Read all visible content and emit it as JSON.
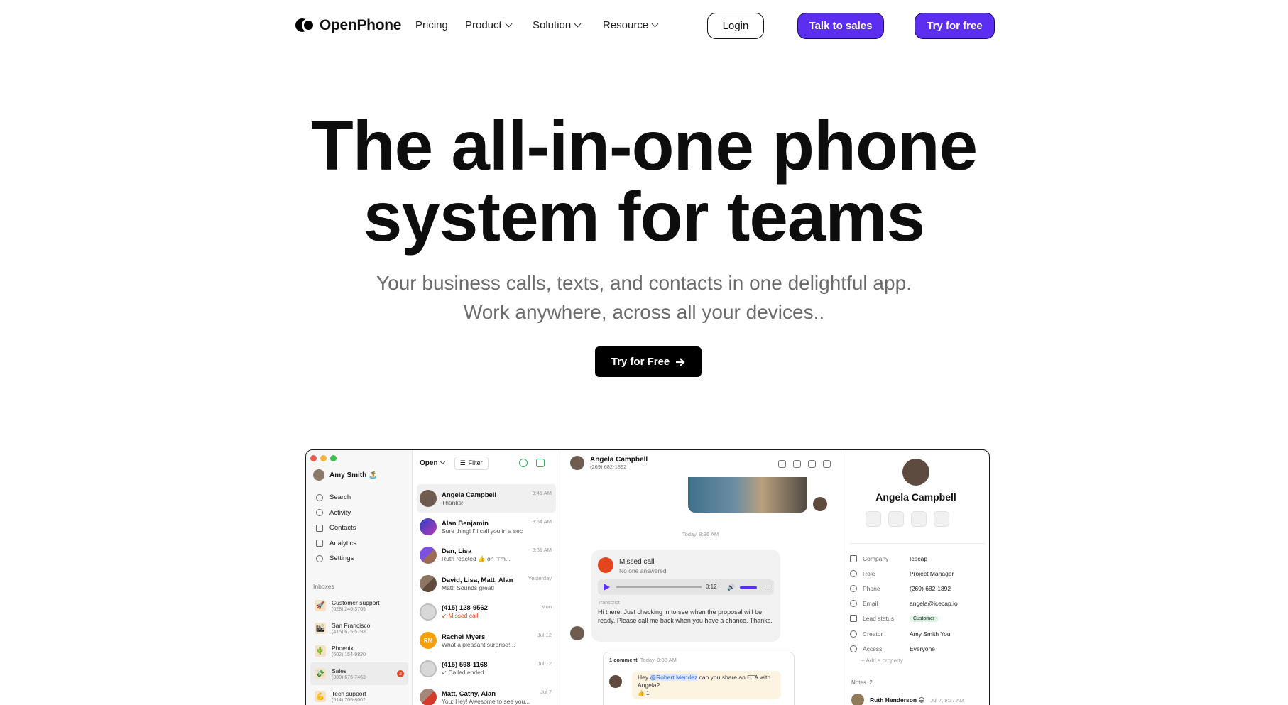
{
  "nav": {
    "brand": "OpenPhone",
    "links": [
      {
        "label": "Pricing",
        "dropdown": false
      },
      {
        "label": "Product",
        "dropdown": true
      },
      {
        "label": "Solution",
        "dropdown": true
      },
      {
        "label": "Resource",
        "dropdown": true
      }
    ],
    "login": "Login",
    "talk_to_sales": "Talk to sales",
    "try_free": "Try for free"
  },
  "hero": {
    "title_line1": "The all-in-one phone",
    "title_line2": "system for teams",
    "subtitle_line1": "Your business calls, texts, and contacts in one delightful app.",
    "subtitle_line2": "Work anywhere, across all your devices..",
    "cta": "Try for Free",
    "cta_icon": "arrow-right-icon"
  },
  "colors": {
    "accent": "#5b2ef0",
    "missed": "#e3461f",
    "success": "#2cb45a"
  },
  "app": {
    "sidebar": {
      "user": "Amy Smith 🏝️",
      "nav": [
        {
          "label": "Search",
          "icon": "search-icon"
        },
        {
          "label": "Activity",
          "icon": "bell-icon"
        },
        {
          "label": "Contacts",
          "icon": "contacts-icon"
        },
        {
          "label": "Analytics",
          "icon": "chart-icon"
        },
        {
          "label": "Settings",
          "icon": "gear-icon"
        }
      ],
      "inboxes_title": "Inboxes",
      "inboxes": [
        {
          "name": "Customer support",
          "number": "(628) 246-3765",
          "emoji": "🚀"
        },
        {
          "name": "San Francisco",
          "number": "(415) 675-5793",
          "emoji": "🏙"
        },
        {
          "name": "Phoenix",
          "number": "(602) 154-9820",
          "emoji": "🌵"
        },
        {
          "name": "Sales",
          "number": "(800) 676-7463",
          "emoji": "💸",
          "badge": "2"
        },
        {
          "name": "Tech support",
          "number": "(514) 705-8002",
          "emoji": "💪"
        }
      ]
    },
    "list": {
      "open_label": "Open",
      "filter_label": "Filter",
      "rows": [
        {
          "name": "Angela Campbell",
          "message": "Thanks!",
          "time": "9:41 AM"
        },
        {
          "name": "Alan Benjamin",
          "message": "Sure thing! I'll call you in a sec",
          "time": "8:54 AM"
        },
        {
          "name": "Dan, Lisa",
          "message": "Ruth reacted 👍 on \"I'm...",
          "time": "8:31 AM"
        },
        {
          "name": "David, Lisa, Matt, Alan",
          "message": "Matt: Sounds great!",
          "time": "Yesterday"
        },
        {
          "name": "(415) 128-9562",
          "message": "↙ Missed call",
          "time": "Mon"
        },
        {
          "name": "Rachel Myers",
          "message": "What a pleasant surprise!...",
          "time": "Jul 12",
          "initials": "RM"
        },
        {
          "name": "(415) 598-1168",
          "message": "↙ Called ended",
          "time": "Jul 12"
        },
        {
          "name": "Matt, Cathy, Alan",
          "message": "You: Hey! Awesome to see you...",
          "time": "Jul 7"
        }
      ]
    },
    "conversation": {
      "name": "Angela Campbell",
      "number": "(269) 682-1892",
      "day": "Today, 9:36 AM",
      "missed_title": "Missed call",
      "missed_sub": "No one answered",
      "duration": "0:12",
      "transcript_label": "Transcript",
      "transcript": "Hi there. Just checking in to see when the proposal will be ready. Please call me back when you have a chance. Thanks.",
      "comment_header": "1 comment",
      "comment_time": "Today, 9:38 AM",
      "comment_before": "Hey ",
      "comment_mention": "@Robert Mendez",
      "comment_after": " can you share an ETA with Angela?",
      "comment_reaction": "👍 1"
    },
    "details": {
      "name": "Angela Campbell",
      "properties": [
        {
          "key": "Company",
          "value": "Icecap"
        },
        {
          "key": "Role",
          "value": "Project Manager"
        },
        {
          "key": "Phone",
          "value": "(269) 682-1892"
        },
        {
          "key": "Email",
          "value": "angela@icecap.io"
        },
        {
          "key": "Lead status",
          "value": "Customer"
        },
        {
          "key": "Creator",
          "value": "Amy Smith You"
        },
        {
          "key": "Access",
          "value": "Everyone"
        }
      ],
      "add_property": "Add a property",
      "notes_label": "Notes",
      "notes_count": "2",
      "note_author": "Ruth Henderson 😄",
      "note_time": "Jul 7, 9:37 AM"
    }
  }
}
